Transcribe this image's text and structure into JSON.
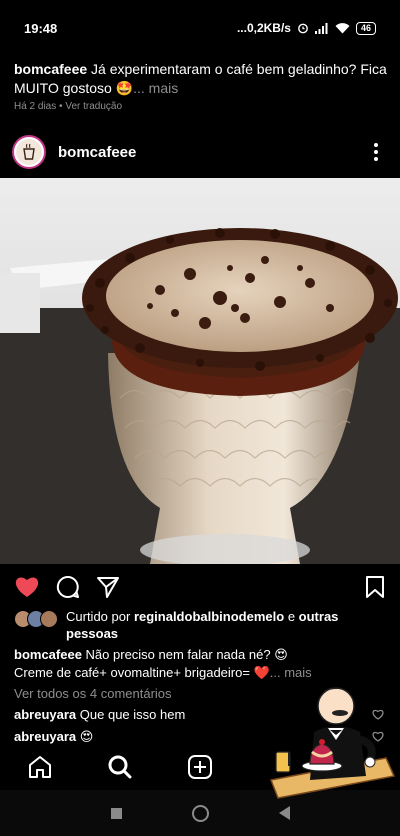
{
  "status": {
    "time": "19:48",
    "network": "...0,2KB/s",
    "battery": "46"
  },
  "top_caption": {
    "user": "bomcafeee",
    "text": "Já experimentaram o café bem geladinho? Fica MUITO gostoso",
    "emoji": "🤩",
    "more": "... mais"
  },
  "meta": {
    "time": "Há 2 dias",
    "separator": "•",
    "translate": "Ver tradução"
  },
  "post": {
    "username": "bomcafeee"
  },
  "likes": {
    "prefix": "Curtido por",
    "user": "reginaldobalbinodemelo",
    "joiner": "e",
    "others": "outras pessoas"
  },
  "caption": {
    "user": "bomcafeee",
    "line1": "Não preciso nem falar nada né?",
    "line1_emoji": "😍",
    "line2": "Creme de café+ ovomaltine+ brigadeiro=",
    "line2_emoji": "❤️",
    "more": "... mais"
  },
  "view_comments": "Ver todos os 4 comentários",
  "comments": [
    {
      "user": "abreuyara",
      "text": "Que que isso hem"
    },
    {
      "user": "abreuyara",
      "text": "😍"
    }
  ],
  "icons": {
    "like": "heart-filled-icon",
    "comment": "comment-icon",
    "share": "send-icon",
    "save": "bookmark-icon",
    "home": "home-icon",
    "search": "search-icon",
    "add": "add-post-icon"
  },
  "colors": {
    "like": "#ed4956",
    "muted": "#8e8e8e",
    "background": "#000000"
  }
}
